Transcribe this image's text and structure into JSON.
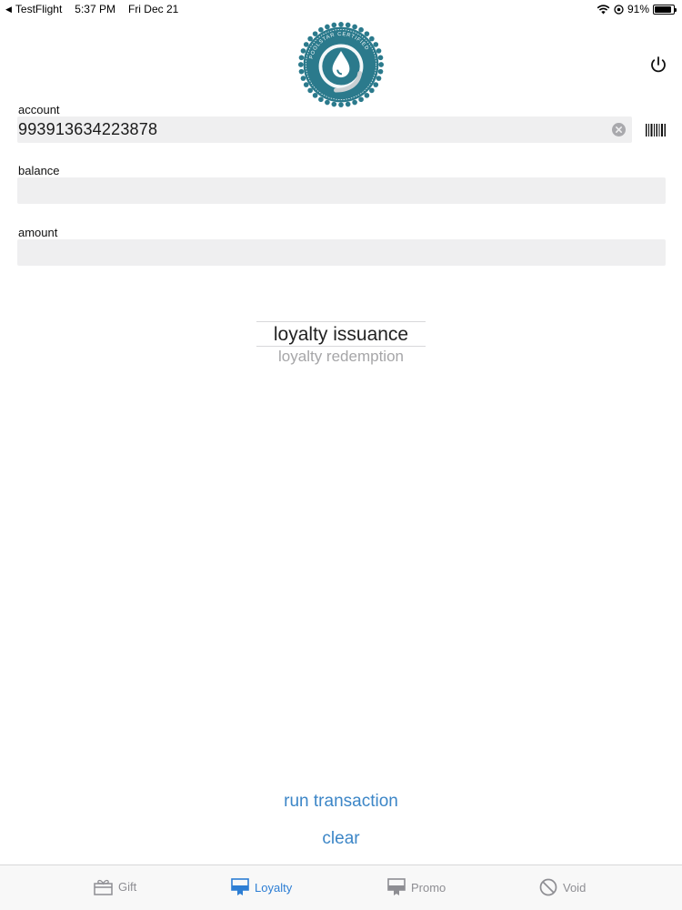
{
  "status_bar": {
    "app": "TestFlight",
    "time": "5:37 PM",
    "date": "Fri Dec 21",
    "battery": "91%",
    "battery_level": 0.91
  },
  "logo": {
    "ring_text": "POOLSTAR CERTIFIED"
  },
  "fields": {
    "account": {
      "label": "account",
      "value": "993913634223878"
    },
    "balance": {
      "label": "balance",
      "value": ""
    },
    "amount": {
      "label": "amount",
      "value": ""
    }
  },
  "picker": {
    "selected": "loyalty issuance",
    "next": "loyalty redemption"
  },
  "actions": {
    "run": "run transaction",
    "clear": "clear"
  },
  "tabs": [
    {
      "label": "Gift",
      "icon": "gift-icon",
      "active": false
    },
    {
      "label": "Loyalty",
      "icon": "card-icon",
      "active": true
    },
    {
      "label": "Promo",
      "icon": "promo-icon",
      "active": false
    },
    {
      "label": "Void",
      "icon": "void-icon",
      "active": false
    }
  ],
  "colors": {
    "accent": "#3c86c7",
    "tab_active": "#2d7ed4",
    "tab_inactive": "#8e8e93",
    "field_bg": "#efeff0",
    "logo_teal": "#2b7a8c"
  }
}
